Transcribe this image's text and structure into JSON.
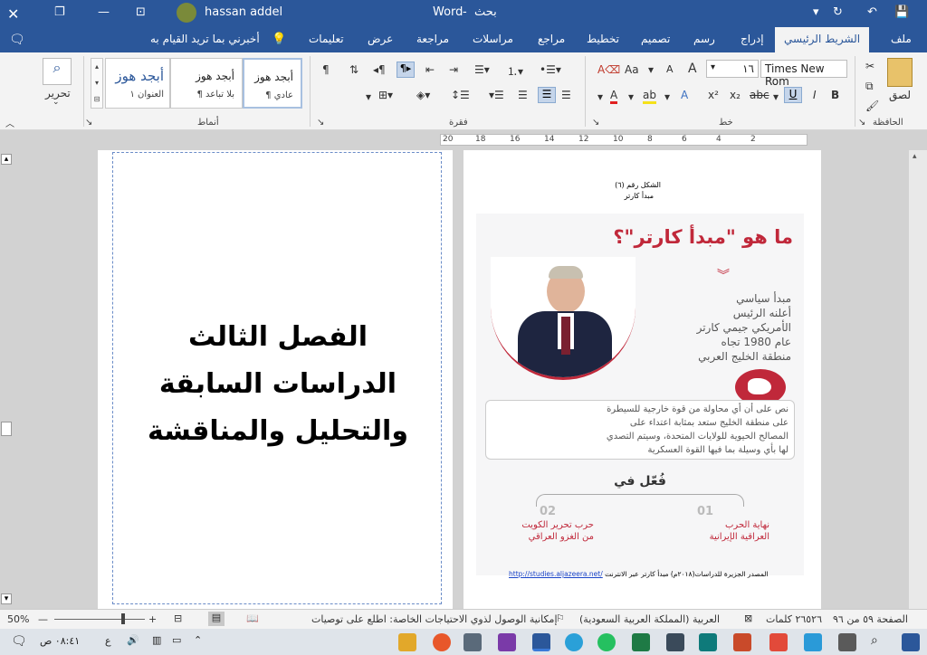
{
  "titlebar": {
    "app_name": "Word",
    "doc_title": "بحث",
    "user_name": "hassan addel"
  },
  "tabs": [
    {
      "label": "ملف"
    },
    {
      "label": "الشريط الرئيسي"
    },
    {
      "label": "إدراج"
    },
    {
      "label": "رسم"
    },
    {
      "label": "تصميم"
    },
    {
      "label": "تخطيط"
    },
    {
      "label": "مراجع"
    },
    {
      "label": "مراسلات"
    },
    {
      "label": "مراجعة"
    },
    {
      "label": "عرض"
    },
    {
      "label": "تعليمات"
    },
    {
      "label": "أخبرني بما تريد القيام به"
    }
  ],
  "ribbon": {
    "clipboard": {
      "paste_label": "لصق",
      "group_label": "الحافظة"
    },
    "font": {
      "font_name": "Times New Rom",
      "font_size": "١٦",
      "group_label": "خط",
      "bold": "B",
      "italic": "I",
      "underline": "U",
      "strike": "abc",
      "sub": "x₂",
      "sup": "x²",
      "grow": "A",
      "shrink": "A",
      "case": "Aa"
    },
    "paragraph": {
      "group_label": "فقرة"
    },
    "styles": {
      "group_label": "أنماط",
      "items": [
        {
          "preview": "أبجد هوز",
          "name": "¶ عادي"
        },
        {
          "preview": "أبجد هوز",
          "name": "¶ بلا تباعد"
        },
        {
          "preview": "أبجد هوز",
          "name": "العنوان ١"
        }
      ]
    },
    "editing": {
      "label": "تحرير"
    }
  },
  "ruler": {
    "marks": [
      "20",
      "18",
      "16",
      "14",
      "12",
      "10",
      "8",
      "6",
      "4",
      "2"
    ]
  },
  "left_page": {
    "lines": [
      "الفصل الثالث",
      "الدراسات السابقة",
      "والتحليل والمناقشة"
    ]
  },
  "right_page": {
    "caption_line1": "الشكل رقم (٦)",
    "caption_line2": "مبدأ كارتر",
    "infographic": {
      "headline": "ما هو \"مبدأ كارتر\"؟",
      "desc_lines": [
        "مبدأ سياسي",
        "أعلنه الرئيس",
        "الأمريكي جيمي كارتر",
        "عام 1980 تجاه",
        "منطقة الخليج العربي"
      ],
      "quote_lines": [
        "نص على أن أي محاولة من قوة خارجية للسيطرة",
        "على منطقة الخليج ستعد بمثابة اعتداء على",
        "المصالح الحيوية للولايات المتحدة، وسيتم التصدي",
        "لها بأي وسيلة بما فيها القوة العسكرية"
      ],
      "applied_in": "فُعّل في",
      "item1_num": "01",
      "item1_lines": [
        "نهاية الحرب",
        "العراقية الإيرانية"
      ],
      "item2_num": "02",
      "item2_lines": [
        "حرب تحرير الكويت",
        "من الغزو العراقي"
      ]
    },
    "source_text": "المصدر الجزيرة للدراسات(٢٠١٨م) مبدأ كارتر عبر الانترنت",
    "source_url": "http://studies.aljazeera.net/"
  },
  "status": {
    "page": "الصفحة ٥٩ من ٩٦",
    "words": "٢٦٥٢٦ كلمات",
    "language": "العربية (المملكة العربية السعودية)",
    "accessibility": "إمكانية الوصول لذوي الاحتياجات الخاصة: اطلع على توصيات",
    "zoom": "50%"
  },
  "taskbar": {
    "time": "٠٨:٤١ ص",
    "lang": "ع"
  },
  "colors": {
    "word_blue": "#2b579a",
    "accent_red": "#c0392b"
  }
}
